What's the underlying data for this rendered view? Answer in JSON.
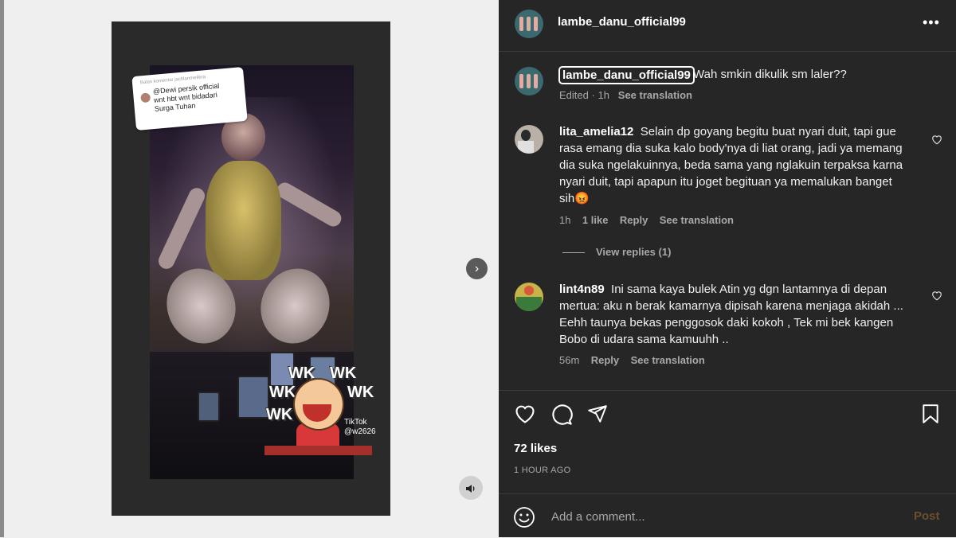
{
  "media": {
    "caption_card_header": "Balas komentar jachlanmeifera",
    "caption_card_text": "@Dewi persik official\nwnt hbt wnt bidadari\nSurga Tuhan",
    "sticker_text": [
      "WK",
      "WK",
      "WK",
      "WK",
      "WK"
    ],
    "tiktok_brand": "TikTok",
    "tiktok_handle": "@w2626",
    "next_icon": "chevron-right-icon",
    "mute_icon": "speaker-icon"
  },
  "header": {
    "username": "lambe_danu_official99",
    "more_icon": "more-horizontal-icon"
  },
  "caption": {
    "username": "lambe_danu_official99",
    "text": "Wah smkin dikulik sm laler??",
    "edited": "Edited",
    "sep": "·",
    "time": "1h",
    "see_translation": "See translation"
  },
  "comments": [
    {
      "username": "lita_amelia12",
      "text": "Selain dp goyang begitu buat nyari duit, tapi gue rasa emang dia suka kalo body'nya di liat orang, jadi ya memang dia suka ngelakuinnya, beda sama yang nglakuin terpaksa karna nyari duit, tapi apapun itu joget begituan ya memalukan banget sih😡",
      "time": "1h",
      "likes": "1 like",
      "reply": "Reply",
      "see_translation": "See translation",
      "view_replies": "View replies (1)"
    },
    {
      "username": "lint4n89",
      "text": "Ini sama kaya bulek Atin yg dgn lantamnya di depan mertua: aku n berak kamarnya dipisah karena menjaga akidah ... Eehh taunya bekas penggosok daki kokoh , Tek mi bek kangen Bobo di udara sama kamuuhh ..",
      "time": "56m",
      "reply": "Reply",
      "see_translation": "See translation"
    }
  ],
  "actions": {
    "likes": "72 likes",
    "time_ago": "1 HOUR AGO",
    "icons": [
      "heart-icon",
      "comment-icon",
      "share-icon",
      "bookmark-icon"
    ]
  },
  "add_comment": {
    "placeholder": "Add a comment...",
    "post_label": "Post",
    "emoji_icon": "emoji-icon"
  },
  "colors": {
    "panel_bg": "#262626",
    "page_bg": "#efefef",
    "muted_text": "#a8a8a8",
    "post_disabled": "#6b4e2e"
  }
}
